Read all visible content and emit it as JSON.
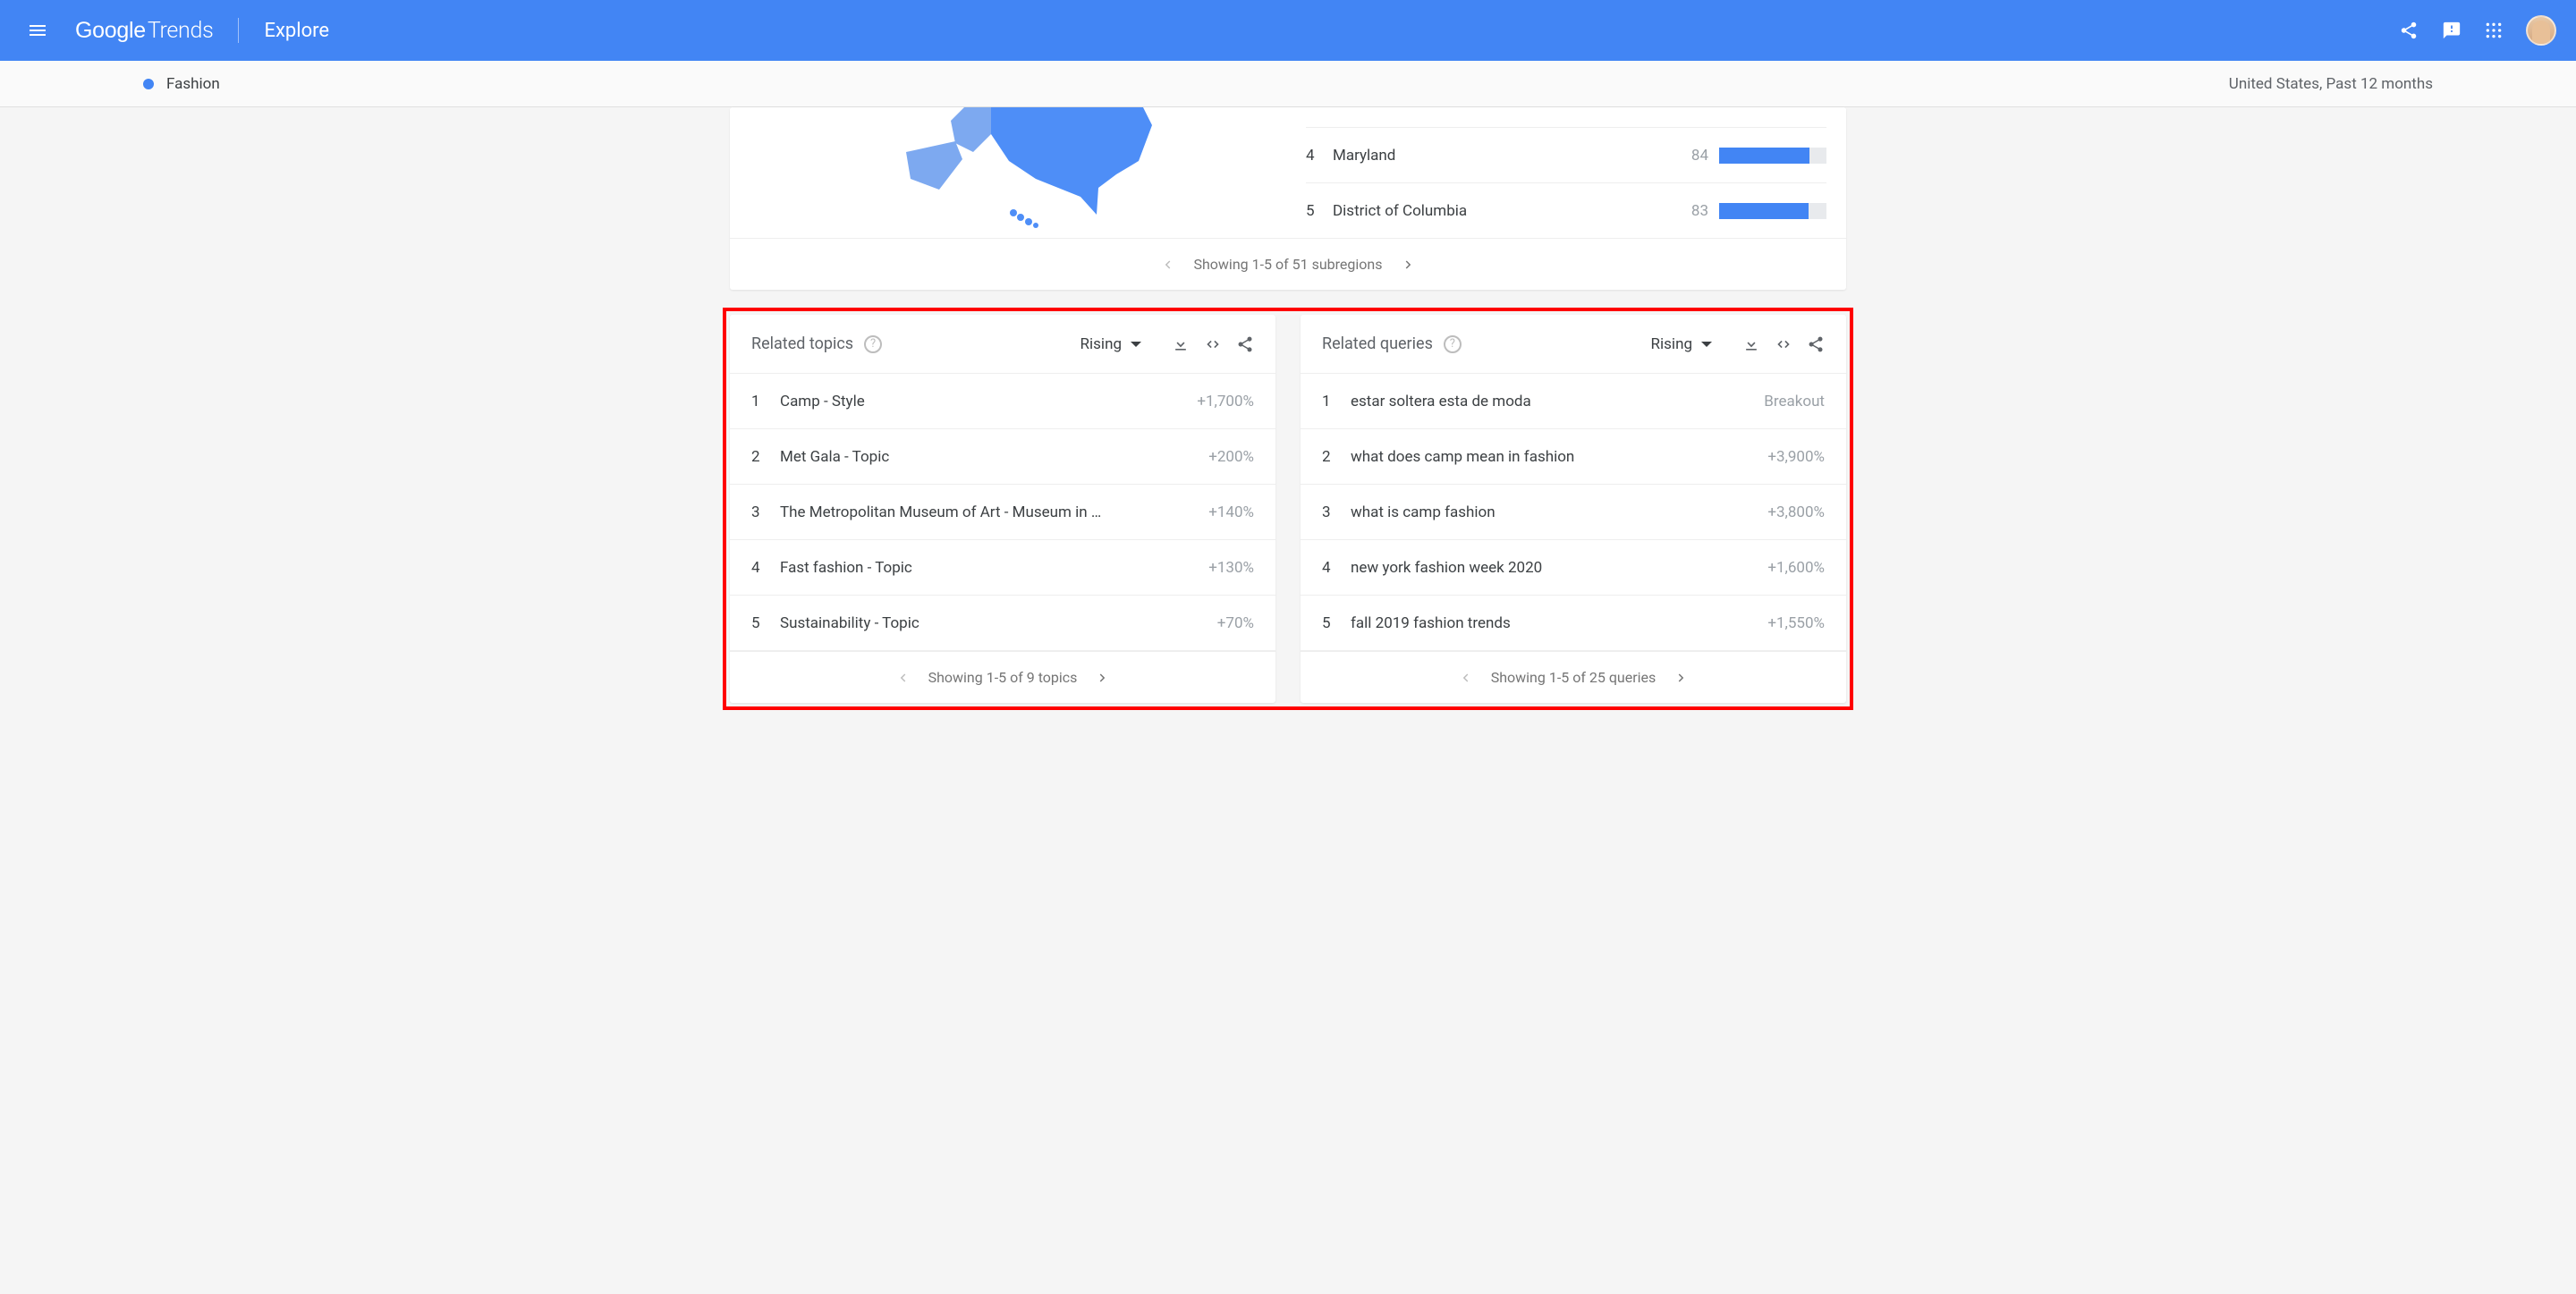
{
  "header": {
    "logo_google": "Google",
    "logo_trends": "Trends",
    "explore": "Explore"
  },
  "filter": {
    "term": "Fashion",
    "right": "United States, Past 12 months"
  },
  "regions": {
    "rows": [
      {
        "rank": "4",
        "name": "Maryland",
        "value": "84",
        "width": 84
      },
      {
        "rank": "5",
        "name": "District of Columbia",
        "value": "83",
        "width": 83
      }
    ],
    "footer": "Showing 1-5 of 51 subregions"
  },
  "related_topics": {
    "title": "Related topics",
    "sort": "Rising",
    "rows": [
      {
        "rank": "1",
        "label": "Camp - Style",
        "value": "+1,700%"
      },
      {
        "rank": "2",
        "label": "Met Gala - Topic",
        "value": "+200%"
      },
      {
        "rank": "3",
        "label": "The Metropolitan Museum of Art - Museum in …",
        "value": "+140%"
      },
      {
        "rank": "4",
        "label": "Fast fashion - Topic",
        "value": "+130%"
      },
      {
        "rank": "5",
        "label": "Sustainability - Topic",
        "value": "+70%"
      }
    ],
    "footer": "Showing 1-5 of 9 topics"
  },
  "related_queries": {
    "title": "Related queries",
    "sort": "Rising",
    "rows": [
      {
        "rank": "1",
        "label": "estar soltera esta de moda",
        "value": "Breakout"
      },
      {
        "rank": "2",
        "label": "what does camp mean in fashion",
        "value": "+3,900%"
      },
      {
        "rank": "3",
        "label": "what is camp fashion",
        "value": "+3,800%"
      },
      {
        "rank": "4",
        "label": "new york fashion week 2020",
        "value": "+1,600%"
      },
      {
        "rank": "5",
        "label": "fall 2019 fashion trends",
        "value": "+1,550%"
      }
    ],
    "footer": "Showing 1-5 of 25 queries"
  }
}
